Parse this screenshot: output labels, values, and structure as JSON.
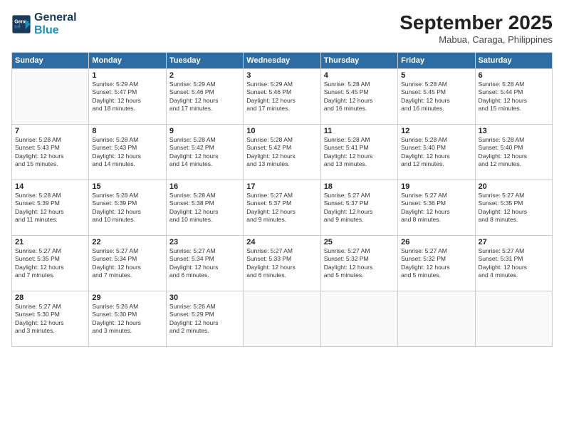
{
  "logo": {
    "line1": "General",
    "line2": "Blue"
  },
  "title": "September 2025",
  "subtitle": "Mabua, Caraga, Philippines",
  "weekdays": [
    "Sunday",
    "Monday",
    "Tuesday",
    "Wednesday",
    "Thursday",
    "Friday",
    "Saturday"
  ],
  "weeks": [
    [
      {
        "day": "",
        "info": ""
      },
      {
        "day": "1",
        "info": "Sunrise: 5:29 AM\nSunset: 5:47 PM\nDaylight: 12 hours\nand 18 minutes."
      },
      {
        "day": "2",
        "info": "Sunrise: 5:29 AM\nSunset: 5:46 PM\nDaylight: 12 hours\nand 17 minutes."
      },
      {
        "day": "3",
        "info": "Sunrise: 5:29 AM\nSunset: 5:46 PM\nDaylight: 12 hours\nand 17 minutes."
      },
      {
        "day": "4",
        "info": "Sunrise: 5:28 AM\nSunset: 5:45 PM\nDaylight: 12 hours\nand 16 minutes."
      },
      {
        "day": "5",
        "info": "Sunrise: 5:28 AM\nSunset: 5:45 PM\nDaylight: 12 hours\nand 16 minutes."
      },
      {
        "day": "6",
        "info": "Sunrise: 5:28 AM\nSunset: 5:44 PM\nDaylight: 12 hours\nand 15 minutes."
      }
    ],
    [
      {
        "day": "7",
        "info": "Sunrise: 5:28 AM\nSunset: 5:43 PM\nDaylight: 12 hours\nand 15 minutes."
      },
      {
        "day": "8",
        "info": "Sunrise: 5:28 AM\nSunset: 5:43 PM\nDaylight: 12 hours\nand 14 minutes."
      },
      {
        "day": "9",
        "info": "Sunrise: 5:28 AM\nSunset: 5:42 PM\nDaylight: 12 hours\nand 14 minutes."
      },
      {
        "day": "10",
        "info": "Sunrise: 5:28 AM\nSunset: 5:42 PM\nDaylight: 12 hours\nand 13 minutes."
      },
      {
        "day": "11",
        "info": "Sunrise: 5:28 AM\nSunset: 5:41 PM\nDaylight: 12 hours\nand 13 minutes."
      },
      {
        "day": "12",
        "info": "Sunrise: 5:28 AM\nSunset: 5:40 PM\nDaylight: 12 hours\nand 12 minutes."
      },
      {
        "day": "13",
        "info": "Sunrise: 5:28 AM\nSunset: 5:40 PM\nDaylight: 12 hours\nand 12 minutes."
      }
    ],
    [
      {
        "day": "14",
        "info": "Sunrise: 5:28 AM\nSunset: 5:39 PM\nDaylight: 12 hours\nand 11 minutes."
      },
      {
        "day": "15",
        "info": "Sunrise: 5:28 AM\nSunset: 5:39 PM\nDaylight: 12 hours\nand 10 minutes."
      },
      {
        "day": "16",
        "info": "Sunrise: 5:28 AM\nSunset: 5:38 PM\nDaylight: 12 hours\nand 10 minutes."
      },
      {
        "day": "17",
        "info": "Sunrise: 5:27 AM\nSunset: 5:37 PM\nDaylight: 12 hours\nand 9 minutes."
      },
      {
        "day": "18",
        "info": "Sunrise: 5:27 AM\nSunset: 5:37 PM\nDaylight: 12 hours\nand 9 minutes."
      },
      {
        "day": "19",
        "info": "Sunrise: 5:27 AM\nSunset: 5:36 PM\nDaylight: 12 hours\nand 8 minutes."
      },
      {
        "day": "20",
        "info": "Sunrise: 5:27 AM\nSunset: 5:35 PM\nDaylight: 12 hours\nand 8 minutes."
      }
    ],
    [
      {
        "day": "21",
        "info": "Sunrise: 5:27 AM\nSunset: 5:35 PM\nDaylight: 12 hours\nand 7 minutes."
      },
      {
        "day": "22",
        "info": "Sunrise: 5:27 AM\nSunset: 5:34 PM\nDaylight: 12 hours\nand 7 minutes."
      },
      {
        "day": "23",
        "info": "Sunrise: 5:27 AM\nSunset: 5:34 PM\nDaylight: 12 hours\nand 6 minutes."
      },
      {
        "day": "24",
        "info": "Sunrise: 5:27 AM\nSunset: 5:33 PM\nDaylight: 12 hours\nand 6 minutes."
      },
      {
        "day": "25",
        "info": "Sunrise: 5:27 AM\nSunset: 5:32 PM\nDaylight: 12 hours\nand 5 minutes."
      },
      {
        "day": "26",
        "info": "Sunrise: 5:27 AM\nSunset: 5:32 PM\nDaylight: 12 hours\nand 5 minutes."
      },
      {
        "day": "27",
        "info": "Sunrise: 5:27 AM\nSunset: 5:31 PM\nDaylight: 12 hours\nand 4 minutes."
      }
    ],
    [
      {
        "day": "28",
        "info": "Sunrise: 5:27 AM\nSunset: 5:30 PM\nDaylight: 12 hours\nand 3 minutes."
      },
      {
        "day": "29",
        "info": "Sunrise: 5:26 AM\nSunset: 5:30 PM\nDaylight: 12 hours\nand 3 minutes."
      },
      {
        "day": "30",
        "info": "Sunrise: 5:26 AM\nSunset: 5:29 PM\nDaylight: 12 hours\nand 2 minutes."
      },
      {
        "day": "",
        "info": ""
      },
      {
        "day": "",
        "info": ""
      },
      {
        "day": "",
        "info": ""
      },
      {
        "day": "",
        "info": ""
      }
    ]
  ]
}
